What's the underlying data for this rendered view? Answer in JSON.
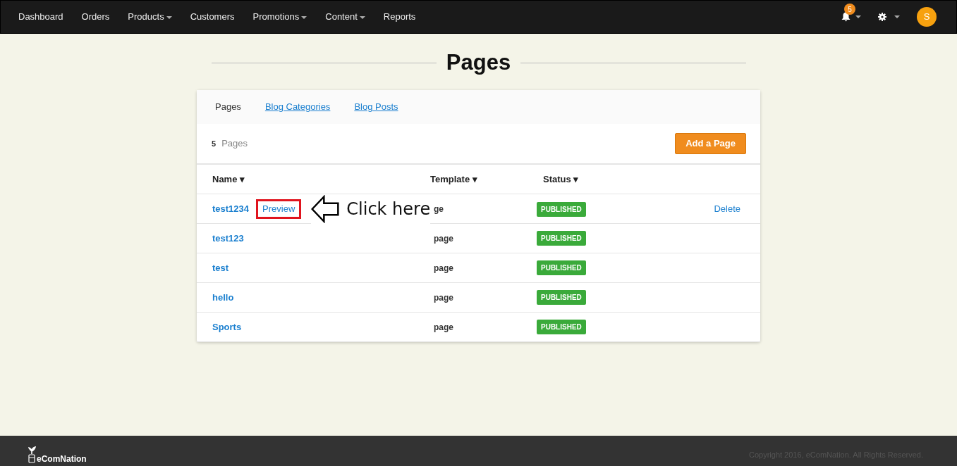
{
  "navbar": {
    "items": [
      {
        "label": "Dashboard",
        "dropdown": false
      },
      {
        "label": "Orders",
        "dropdown": false
      },
      {
        "label": "Products",
        "dropdown": true
      },
      {
        "label": "Customers",
        "dropdown": false
      },
      {
        "label": "Promotions",
        "dropdown": true
      },
      {
        "label": "Content",
        "dropdown": true
      },
      {
        "label": "Reports",
        "dropdown": false
      }
    ],
    "notification_count": "5",
    "avatar": "S"
  },
  "heading": "Pages",
  "tabs": [
    {
      "label": "Pages",
      "selected": true
    },
    {
      "label": "Blog Categories",
      "selected": false
    },
    {
      "label": "Blog Posts",
      "selected": false
    }
  ],
  "count": {
    "number": "5",
    "label": "Pages"
  },
  "add_button": "Add a Page",
  "table": {
    "columns": [
      "Name ▾",
      "Template ▾",
      "Status ▾"
    ],
    "rows": [
      {
        "name": "test1234",
        "preview": "Preview",
        "highlighted": true,
        "template": "ge",
        "status": "PUBLISHED",
        "delete": "Delete"
      },
      {
        "name": "test123",
        "template": "page",
        "status": "PUBLISHED"
      },
      {
        "name": "test",
        "template": "page",
        "status": "PUBLISHED"
      },
      {
        "name": "hello",
        "template": "page",
        "status": "PUBLISHED"
      },
      {
        "name": "Sports",
        "template": "page",
        "status": "PUBLISHED"
      }
    ]
  },
  "annotation": {
    "text": "Click here"
  },
  "footer": {
    "brand": "eComNation",
    "copyright": "Copyright 2016, eComNation. All Rights Reserved."
  }
}
